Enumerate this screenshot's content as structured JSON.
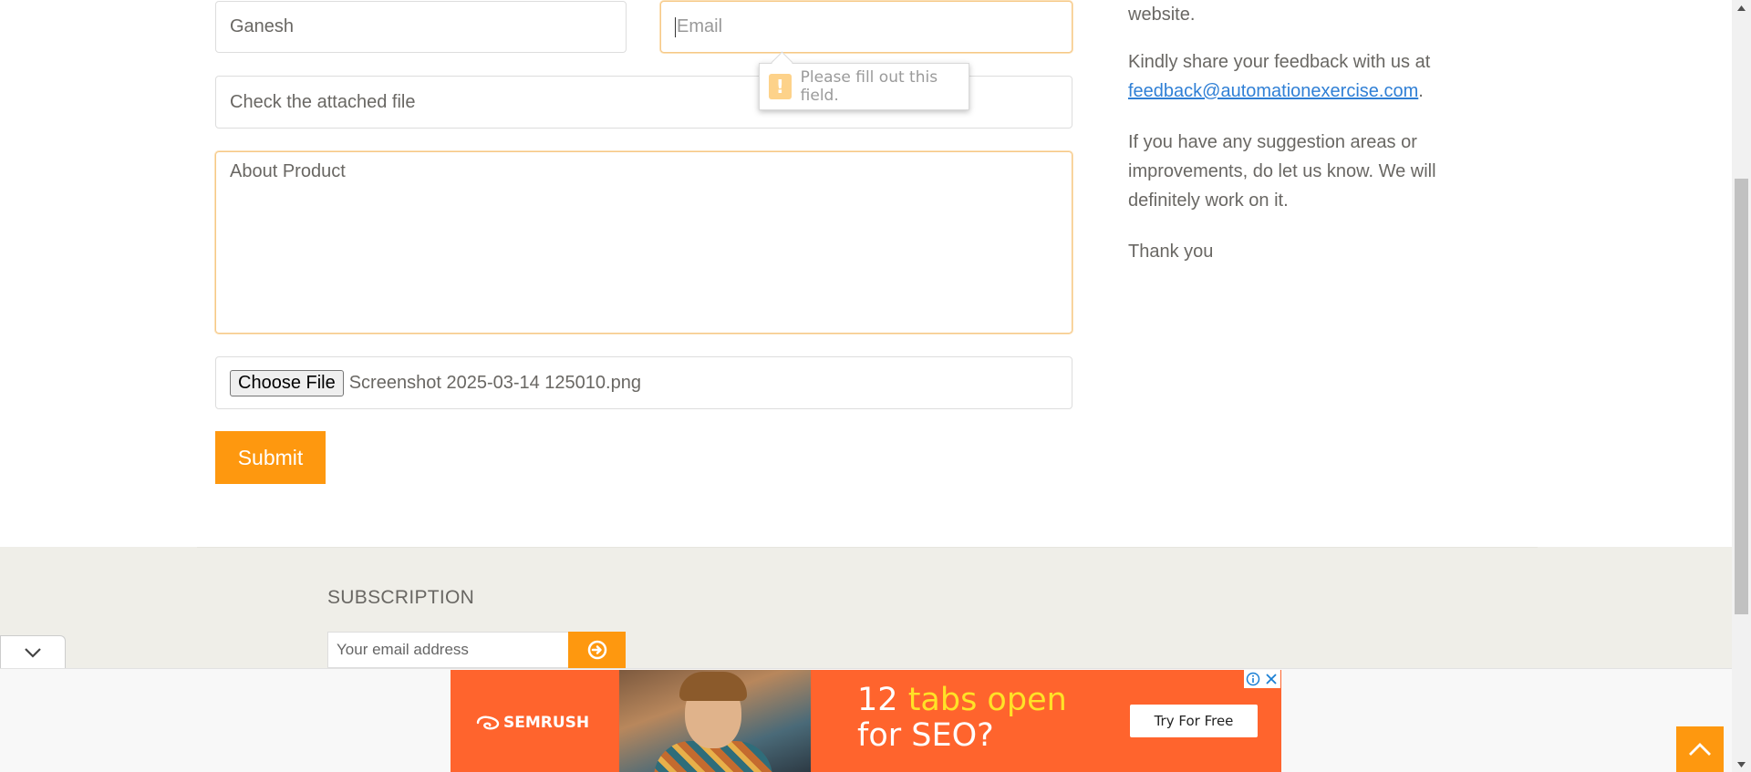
{
  "form": {
    "name_value": "Ganesh",
    "email_placeholder": "Email",
    "subject_value": "Check the attached file",
    "message_value": "About Product",
    "file_button_label": "Choose File",
    "file_name": "Screenshot 2025-03-14 125010.png",
    "submit_label": "Submit",
    "validation_message": "Please fill out this field."
  },
  "right_column": {
    "line1": "website.",
    "line2_prefix": "Kindly share your feedback with us at",
    "feedback_email": "feedback@automationexercise.com",
    "line2_suffix": ".",
    "line3": "If you have any suggestion areas or improvements, do let us know. We will definitely work on it.",
    "line4": "Thank you"
  },
  "footer": {
    "subscription_title": "SUBSCRIPTION",
    "email_placeholder": "Your email address"
  },
  "ad": {
    "brand": "SEMRUSH",
    "headline_number": "12",
    "headline_highlight": "tabs open",
    "headline_line2": "for SEO?",
    "cta": "Try For Free"
  },
  "colors": {
    "accent": "#fe980f",
    "ad_background": "#ff642d",
    "ad_highlight": "#ffe227",
    "link": "#2f7fd5",
    "footer_bg": "#efeee8"
  }
}
